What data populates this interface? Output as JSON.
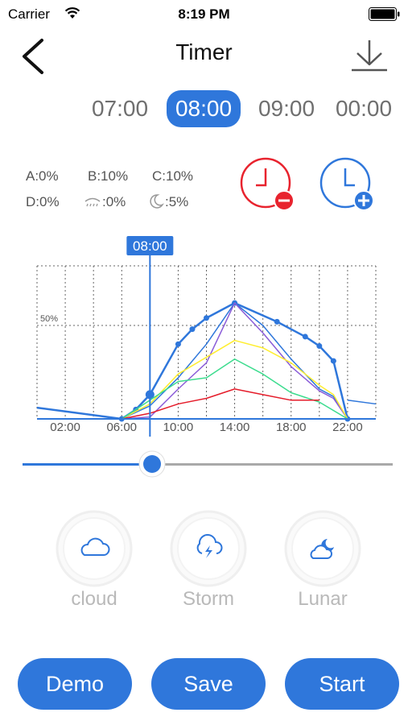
{
  "status_bar": {
    "carrier": "Carrier",
    "time": "8:19 PM"
  },
  "header": {
    "title": "Timer"
  },
  "time_tabs": [
    {
      "label": "07:00",
      "active": false
    },
    {
      "label": "08:00",
      "active": true
    },
    {
      "label": "09:00",
      "active": false
    },
    {
      "label": "00:00",
      "active": false
    }
  ],
  "channel_levels": {
    "a": "A:0%",
    "b": "B:10%",
    "c": "C:10%",
    "d": "D:0%",
    "cloud": ":0%",
    "moon": ":5%"
  },
  "actions": {
    "remove_icon": "clock-minus-icon",
    "add_icon": "clock-plus-icon"
  },
  "chart_data": {
    "type": "line",
    "cursor_label": "08:00",
    "cursor_x": 8,
    "x_ticks": [
      "02:00",
      "06:00",
      "10:00",
      "14:00",
      "18:00",
      "22:00"
    ],
    "x_tick_values": [
      2,
      6,
      10,
      14,
      18,
      22
    ],
    "y_tick_label": "50%",
    "y_tick_value": 50,
    "xlim": [
      0,
      24
    ],
    "ylim": [
      0,
      100
    ],
    "grid": true,
    "series": [
      {
        "color": "#2f77db",
        "markers": true,
        "points": [
          [
            0,
            6
          ],
          [
            6,
            0
          ],
          [
            7,
            5
          ],
          [
            8,
            13
          ],
          [
            10,
            40
          ],
          [
            11,
            48
          ],
          [
            12,
            54
          ],
          [
            14,
            62
          ],
          [
            17,
            52
          ],
          [
            19,
            44
          ],
          [
            20,
            39
          ],
          [
            21,
            31
          ],
          [
            22,
            0
          ]
        ]
      },
      {
        "color": "#2f77db",
        "markers": false,
        "points": [
          [
            6,
            0
          ],
          [
            8,
            7
          ],
          [
            10,
            22
          ],
          [
            12,
            40
          ],
          [
            14,
            62
          ],
          [
            16,
            50
          ],
          [
            18,
            32
          ],
          [
            20,
            16
          ],
          [
            21,
            12
          ],
          [
            22,
            0
          ]
        ]
      },
      {
        "color": "#8a5cd8",
        "markers": false,
        "points": [
          [
            6,
            0
          ],
          [
            8,
            1
          ],
          [
            10,
            16
          ],
          [
            12,
            30
          ],
          [
            14,
            62
          ],
          [
            16,
            46
          ],
          [
            18,
            28
          ],
          [
            20,
            15
          ],
          [
            21,
            11
          ],
          [
            22,
            0
          ]
        ]
      },
      {
        "color": "#ffee30",
        "markers": false,
        "points": [
          [
            6,
            0
          ],
          [
            8,
            8
          ],
          [
            10,
            24
          ],
          [
            12,
            33
          ],
          [
            14,
            42
          ],
          [
            16,
            38
          ],
          [
            18,
            30
          ],
          [
            20,
            18
          ],
          [
            21,
            13
          ],
          [
            22,
            0
          ]
        ]
      },
      {
        "color": "#3cdc8e",
        "markers": false,
        "points": [
          [
            6,
            0
          ],
          [
            8,
            10
          ],
          [
            10,
            20
          ],
          [
            12,
            22
          ],
          [
            14,
            32
          ],
          [
            16,
            24
          ],
          [
            18,
            14
          ],
          [
            20,
            9
          ],
          [
            22,
            0
          ]
        ]
      },
      {
        "color": "#e51c2a",
        "markers": false,
        "points": [
          [
            6,
            0
          ],
          [
            8,
            3
          ],
          [
            10,
            8
          ],
          [
            12,
            11
          ],
          [
            14,
            16
          ],
          [
            16,
            13
          ],
          [
            18,
            10
          ],
          [
            20,
            10
          ]
        ]
      },
      {
        "color": "#2f77db",
        "markers": false,
        "points": [
          [
            22,
            10
          ],
          [
            24,
            8
          ]
        ]
      }
    ]
  },
  "slider": {
    "value_fraction": 0.35
  },
  "weather": [
    {
      "label": "cloud",
      "icon": "cloud-icon"
    },
    {
      "label": "Storm",
      "icon": "storm-icon"
    },
    {
      "label": "Lunar",
      "icon": "lunar-icon"
    }
  ],
  "buttons": {
    "demo": "Demo",
    "save": "Save",
    "start": "Start"
  },
  "colors": {
    "accent": "#2f77db",
    "remove": "#e8232e",
    "inactive_text": "#b9b9b9"
  }
}
